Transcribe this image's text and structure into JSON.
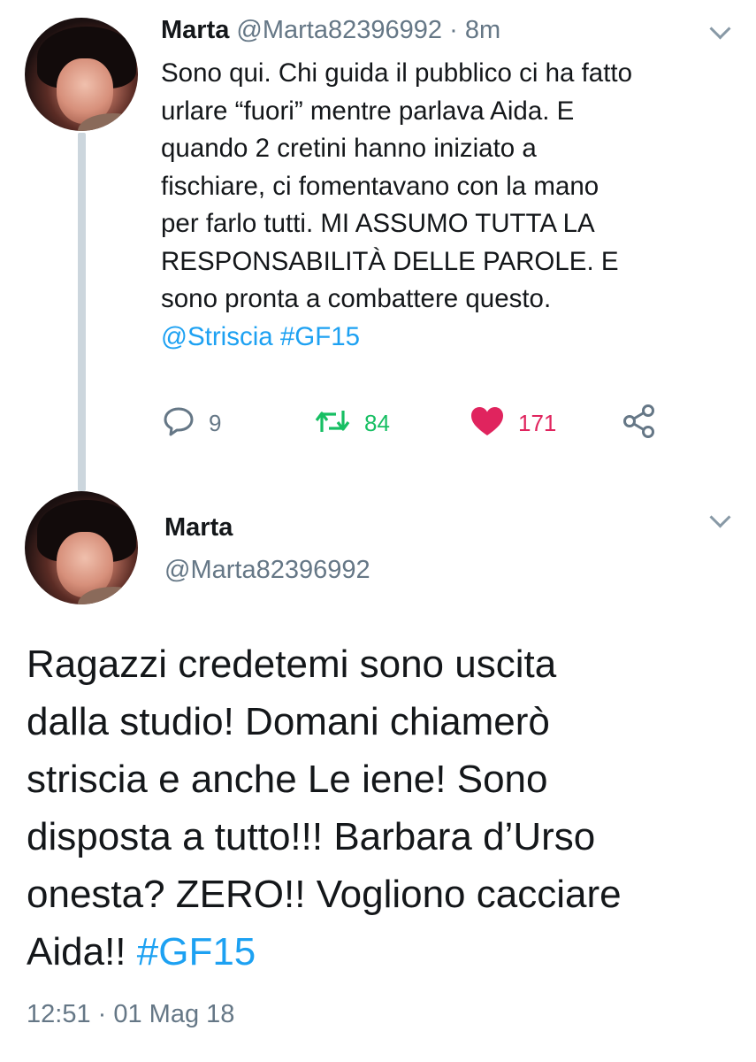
{
  "thread": {
    "tweet1": {
      "author_name": "Marta",
      "handle": "@Marta82396992",
      "separator": "·",
      "time_ago": "8m",
      "body_lines": [
        "Sono qui. Chi guida il pubblico ci ha fatto",
        "urlare “fuori” mentre parlava Aida. E",
        "quando 2 cretini hanno iniziato a",
        "fischiare, ci fomentavano con la mano",
        "per farlo tutti. MI ASSUMO TUTTA LA",
        "RESPONSABILITÀ DELLE PAROLE. E",
        "sono pronta a combattere questo."
      ],
      "mentions": [
        "@Striscia",
        "#GF15"
      ],
      "actions": {
        "reply_count": "9",
        "retweet_count": "84",
        "like_count": "171"
      },
      "colors": {
        "reply": "#657786",
        "retweet": "#17bf63",
        "like": "#e0245e",
        "link": "#1da1f2"
      }
    },
    "tweet2": {
      "author_name": "Marta",
      "handle": "@Marta82396992",
      "body_lines": [
        "Ragazzi credetemi sono uscita",
        "dalla studio! Domani chiamerò",
        "striscia e anche Le iene! Sono",
        "disposta a tutto!!! Barbara d’Urso",
        "onesta? ZERO!! Vogliono cacciare",
        "Aida!!"
      ],
      "hashtag": "#GF15",
      "timestamp": "12:51 · 01 Mag 18"
    }
  },
  "icons": {
    "avatar": "profile-photo",
    "menu": "chevron-down-icon",
    "reply": "speech-bubble-icon",
    "retweet": "retweet-arrows-icon",
    "like": "heart-icon",
    "share": "share-nodes-icon"
  }
}
